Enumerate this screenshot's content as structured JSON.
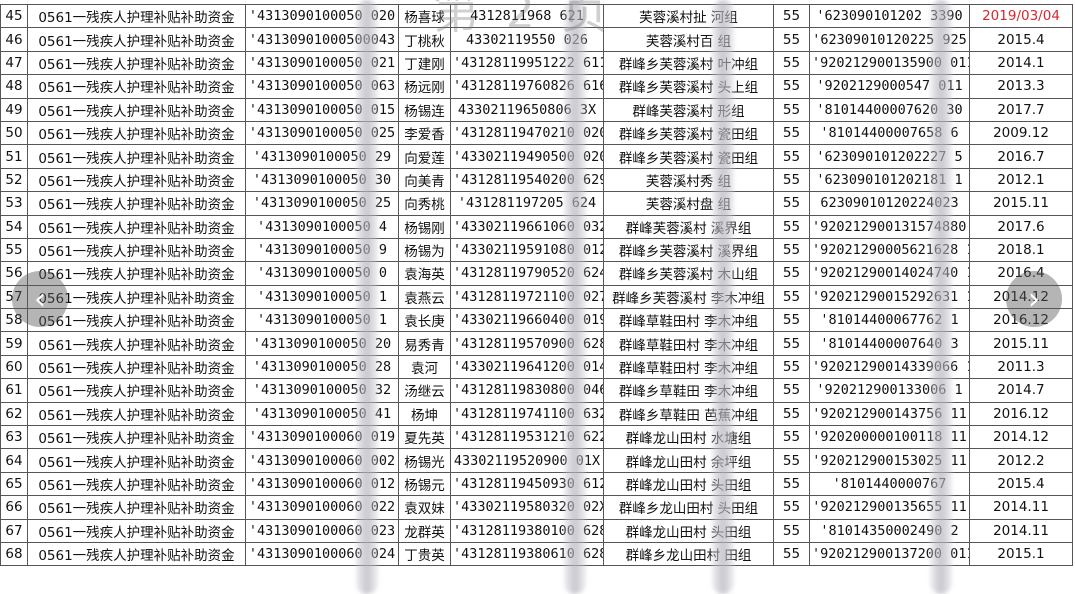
{
  "watermark": "第 2 页",
  "highlight_color": "#d9272e",
  "navigation": {
    "prev_icon": "‹",
    "next_icon": "›"
  },
  "rows": [
    {
      "no": "45",
      "type": "0561一残疾人护理补贴补助资金",
      "id": "'4313090100050  020",
      "name": "杨喜球",
      "idc": "4312811968  621",
      "addr": "芙蓉溪村扯  河组",
      "amt": "55",
      "acct": "'623090101202  3390",
      "date": "2019/03/04"
    },
    {
      "no": "46",
      "type": "0561一残疾人护理补贴补助资金",
      "id": "'43130901000500043",
      "name": "丁桃秋",
      "idc": "43302119550  026",
      "addr": "芙蓉溪村百  组",
      "amt": "55",
      "acct": "'62309010120225  925",
      "date": "2015.4"
    },
    {
      "no": "47",
      "type": "0561一残疾人护理补贴补助资金",
      "id": "'4313090100050  021",
      "name": "丁建刚",
      "idc": "'43128119951222  611",
      "addr": "群峰乡芙蓉溪村  叶冲组",
      "amt": "55",
      "acct": "'920212900135900  011",
      "date": "2014.1"
    },
    {
      "no": "48",
      "type": "0561一残疾人护理补贴补助资金",
      "id": "'4313090100050  063",
      "name": "杨远刚",
      "idc": "'43128119760826  616",
      "addr": "群峰乡芙蓉溪村  头上组",
      "amt": "55",
      "acct": "'9202129000547  011",
      "date": "2013.3"
    },
    {
      "no": "49",
      "type": "0561一残疾人护理补贴补助资金",
      "id": "'4313090100050  015",
      "name": "杨锡连",
      "idc": "43302119650806  3X",
      "addr": "群峰芙蓉溪村  形组",
      "amt": "55",
      "acct": "'81014400007620  30",
      "date": "2017.7"
    },
    {
      "no": "50",
      "type": "0561一残疾人护理补贴补助资金",
      "id": "'4313090100050  025",
      "name": "李爱香",
      "idc": "'43128119470210  020",
      "addr": "群峰乡芙蓉溪村  瓷田组",
      "amt": "55",
      "acct": "'81014400007658  6",
      "date": "2009.12"
    },
    {
      "no": "51",
      "type": "0561一残疾人护理补贴补助资金",
      "id": "'4313090100050  29",
      "name": "向爱莲",
      "idc": "'43302119490500  020",
      "addr": "群峰乡芙蓉溪村  瓷田组",
      "amt": "55",
      "acct": "'623090101202227  5",
      "date": "2016.7"
    },
    {
      "no": "52",
      "type": "0561一残疾人护理补贴补助资金",
      "id": "'4313090100050  30",
      "name": "向美青",
      "idc": "'43128119540200  629",
      "addr": "芙蓉溪村秀  组",
      "amt": "55",
      "acct": "'623090101202181  1",
      "date": "2012.1"
    },
    {
      "no": "53",
      "type": "0561一残疾人护理补贴补助资金",
      "id": "'4313090100050  25",
      "name": "向秀桃",
      "idc": "'431281197205  624",
      "addr": "芙蓉溪村盘  组",
      "amt": "55",
      "acct": "62309010120224023  ",
      "date": "2015.11"
    },
    {
      "no": "54",
      "type": "0561一残疾人护理补贴补助资金",
      "id": "'4313090100050  4",
      "name": "杨锡刚",
      "idc": "'43302119661060  032",
      "addr": "群峰芙蓉溪村  溪界组",
      "amt": "55",
      "acct": "'920212900131574880  1",
      "date": "2017.6"
    },
    {
      "no": "55",
      "type": "0561一残疾人护理补贴补助资金",
      "id": "'4313090100050  9",
      "name": "杨锡为",
      "idc": "'43302119591080  012",
      "addr": "群峰乡芙蓉溪村  溪界组",
      "amt": "55",
      "acct": "'92021290005621628  1",
      "date": "2018.1"
    },
    {
      "no": "56",
      "type": "0561一残疾人护理补贴补助资金",
      "id": "'4313090100050  0",
      "name": "袁海英",
      "idc": "'43128119790520  624",
      "addr": "群峰乡芙蓉溪村  木山组",
      "amt": "55",
      "acct": "'92021290014024740  1",
      "date": "2016.4"
    },
    {
      "no": "57",
      "type": "0561一残疾人护理补贴补助资金",
      "id": "'4313090100050  1",
      "name": "袁燕云",
      "idc": "'43128119721100  027",
      "addr": "群峰乡芙蓉溪村  李木冲组",
      "amt": "55",
      "acct": "'92021290015292631  1",
      "date": "2014.12"
    },
    {
      "no": "58",
      "type": "0561一残疾人护理补贴补助资金",
      "id": "'4313090100050  1",
      "name": "袁长庚",
      "idc": "'43302119660400  019",
      "addr": "群峰草鞋田村  李木冲组",
      "amt": "55",
      "acct": "'81014400067762  1",
      "date": "2016.12"
    },
    {
      "no": "59",
      "type": "0561一残疾人护理补贴补助资金",
      "id": "'4313090100050  20",
      "name": "易秀青",
      "idc": "'43128119570900  628",
      "addr": "群峰草鞋田村  李木冲组",
      "amt": "55",
      "acct": "'81014400007640  3",
      "date": "2015.11"
    },
    {
      "no": "60",
      "type": "0561一残疾人护理补贴补助资金",
      "id": "'4313090100050  28",
      "name": "袁河",
      "idc": "'43302119641200  014",
      "addr": "群峰草鞋田村  李木冲组",
      "amt": "55",
      "acct": "'92021290014339066  1",
      "date": "2011.3"
    },
    {
      "no": "61",
      "type": "0561一残疾人护理补贴补助资金",
      "id": "'4313090100050  32",
      "name": "汤继云",
      "idc": "'43128119830800  046",
      "addr": "群峰乡草鞋田  李木冲组",
      "amt": "55",
      "acct": "'920212900133006  1",
      "date": "2014.7"
    },
    {
      "no": "62",
      "type": "0561一残疾人护理补贴补助资金",
      "id": "'4313090100050  41",
      "name": "杨坤",
      "idc": "'43128119741100  632",
      "addr": "群峰乡草鞋田  芭蕉冲组",
      "amt": "55",
      "acct": "'920212900143756  11",
      "date": "2016.12"
    },
    {
      "no": "63",
      "type": "0561一残疾人护理补贴补助资金",
      "id": "'4313090100060  019",
      "name": "夏先英",
      "idc": "'43128119531210  622",
      "addr": "群峰龙山田村  水塘组",
      "amt": "55",
      "acct": "'920200000100118  11",
      "date": "2014.12"
    },
    {
      "no": "64",
      "type": "0561一残疾人护理补贴补助资金",
      "id": "'4313090100060  002",
      "name": "杨锡光",
      "idc": "43302119520900  01X",
      "addr": "群峰龙山田村  余坪组",
      "amt": "55",
      "acct": "'920212900153025  11",
      "date": "2012.2"
    },
    {
      "no": "65",
      "type": "0561一残疾人护理补贴补助资金",
      "id": "'4313090100060  012",
      "name": "杨锡元",
      "idc": "'43128119450930  612",
      "addr": "群峰龙山田村  头田组",
      "amt": "55",
      "acct": "'8101440000767  ",
      "date": "2015.4"
    },
    {
      "no": "66",
      "type": "0561一残疾人护理补贴补助资金",
      "id": "'4313090100060  022",
      "name": "袁双妹",
      "idc": "'43302119580320  02X",
      "addr": "群峰乡龙山田村  头田组",
      "amt": "55",
      "acct": "'920212900135655  11",
      "date": "2014.11"
    },
    {
      "no": "67",
      "type": "0561一残疾人护理补贴补助资金",
      "id": "'4313090100060  023",
      "name": "龙群英",
      "idc": "'43128119380100  628",
      "addr": "群峰龙山田村  头田组",
      "amt": "55",
      "acct": "'81014350002490  2",
      "date": "2014.11"
    },
    {
      "no": "68",
      "type": "0561一残疾人护理补贴补助资金",
      "id": "'4313090100060  024",
      "name": "丁贵英",
      "idc": "'43128119380610  628",
      "addr": "群峰乡龙山田村  田组",
      "amt": "55",
      "acct": "'920212900137200  011",
      "date": "2015.1"
    }
  ]
}
